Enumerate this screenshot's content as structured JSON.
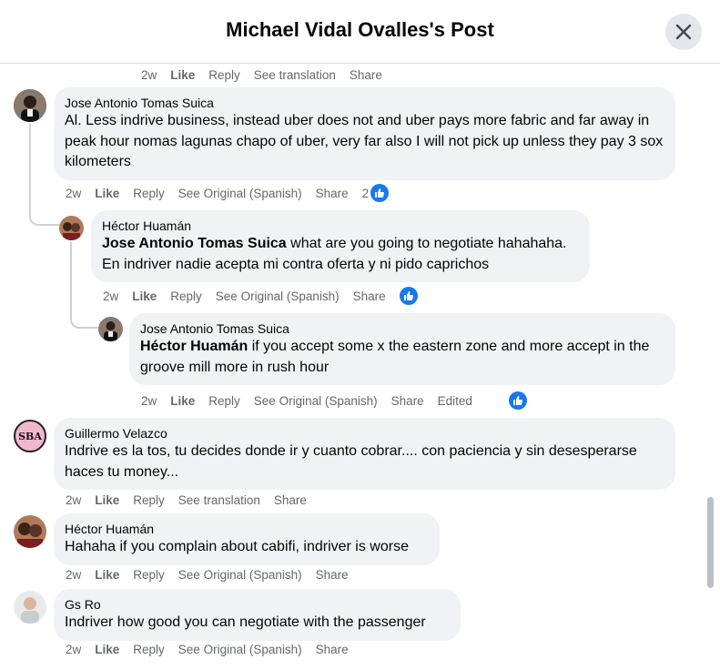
{
  "header": {
    "title": "Michael Vidal Ovalles's Post"
  },
  "top_actions": {
    "time": "2w",
    "like": "Like",
    "reply": "Reply",
    "translate": "See translation",
    "share": "Share"
  },
  "comments": [
    {
      "author": "Jose Antonio Tomas Suica",
      "text": "Al. Less indrive business, instead uber does not and uber pays more fabric and far away in peak hour nomas lagunas chapo of uber, very far also I will not pick up unless they pay 3 sox kilometers",
      "time": "2w",
      "like": "Like",
      "reply": "Reply",
      "translate": "See Original (Spanish)",
      "share": "Share",
      "reactions": "2"
    },
    {
      "author": "Héctor Huamán",
      "mention": "Jose Antonio Tomas Suica",
      "text": " what are you going to negotiate hahahaha. En indriver nadie acepta mi contra oferta y ni pido caprichos",
      "time": "2w",
      "like": "Like",
      "reply": "Reply",
      "translate": "See Original (Spanish)",
      "share": "Share"
    },
    {
      "author": "Jose Antonio Tomas Suica",
      "mention": "Héctor Huamán",
      "text": " if you accept some x the eastern zone and more accept in the groove mill more in rush hour",
      "time": "2w",
      "like": "Like",
      "reply": "Reply",
      "translate": "See Original (Spanish)",
      "share": "Share",
      "edited": "Edited"
    },
    {
      "author": "Guillermo Velazco",
      "avatar_label": "SBA",
      "text": "Indrive es la tos, tu decides donde ir y cuanto cobrar.... con paciencia y sin desesperarse haces tu money...",
      "time": "2w",
      "like": "Like",
      "reply": "Reply",
      "translate": "See translation",
      "share": "Share"
    },
    {
      "author": "Héctor Huamán",
      "text": "Hahaha if you complain about cabifi, indriver is worse",
      "time": "2w",
      "like": "Like",
      "reply": "Reply",
      "translate": "See Original (Spanish)",
      "share": "Share"
    },
    {
      "author": "Gs Ro",
      "text": "Indriver how good you can negotiate with the passenger",
      "time": "2w",
      "like": "Like",
      "reply": "Reply",
      "translate": "See Original (Spanish)",
      "share": "Share"
    }
  ],
  "colors": {
    "accent": "#1877f2",
    "bubble": "#f0f2f5",
    "secondary_text": "#65676b"
  }
}
